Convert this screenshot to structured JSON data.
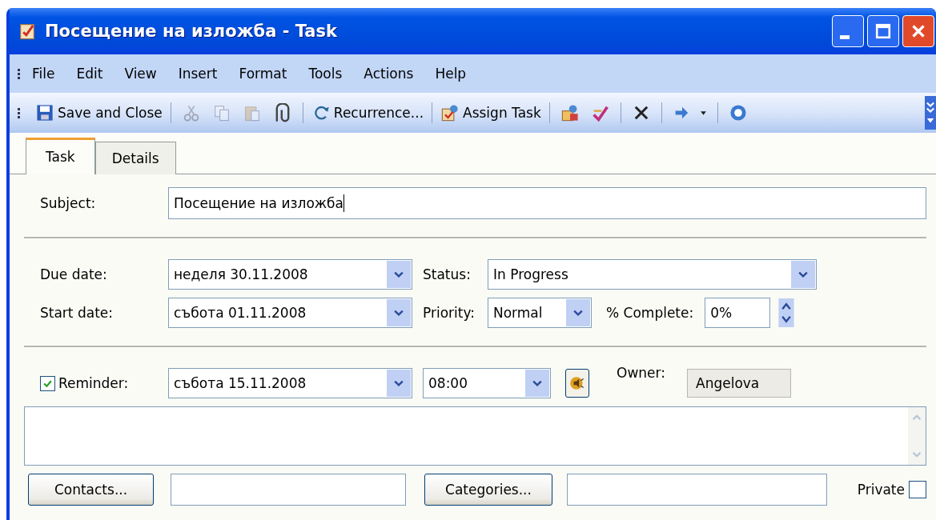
{
  "window": {
    "title": "Посещение на изложба - Task"
  },
  "menu": [
    "File",
    "Edit",
    "View",
    "Insert",
    "Format",
    "Tools",
    "Actions",
    "Help"
  ],
  "toolbar": [
    {
      "kind": "text",
      "label": "Save and Close"
    },
    {
      "kind": "sep"
    },
    {
      "kind": "icon",
      "disabled": true
    },
    {
      "kind": "icon",
      "disabled": true
    },
    {
      "kind": "icon",
      "disabled": true
    },
    {
      "kind": "icon",
      "disabled": false
    },
    {
      "kind": "sep"
    },
    {
      "kind": "text",
      "label": "Recurrence..."
    },
    {
      "kind": "sep"
    },
    {
      "kind": "text",
      "label": "Assign Task"
    },
    {
      "kind": "sep"
    },
    {
      "kind": "icon",
      "disabled": false
    },
    {
      "kind": "icon",
      "disabled": false
    },
    {
      "kind": "sep"
    },
    {
      "kind": "icon",
      "disabled": false
    },
    {
      "kind": "sep"
    },
    {
      "kind": "icon",
      "disabled": false
    },
    {
      "kind": "sep"
    },
    {
      "kind": "icon",
      "disabled": false
    }
  ],
  "tabs": [
    {
      "label": "Task",
      "selected": true
    },
    {
      "label": "Details",
      "selected": false
    }
  ],
  "subject": {
    "label": "Subject:",
    "value": "Посещение на изложба"
  },
  "due_date": {
    "label": "Due date:",
    "value": "неделя 30.11.2008"
  },
  "start_date": {
    "label": "Start date:",
    "value": "събота 01.11.2008"
  },
  "status": {
    "label": "Status:",
    "value": "In Progress"
  },
  "priority": {
    "label": "Priority:",
    "value": "Normal"
  },
  "complete": {
    "label": "% Complete:",
    "value": "0%"
  },
  "reminder": {
    "label": "Reminder:",
    "checked": true,
    "date": "събота 15.11.2008",
    "time": "08:00"
  },
  "owner": {
    "label": "Owner:",
    "value": "Angelova"
  },
  "contacts": {
    "button": "Contacts..."
  },
  "categories": {
    "button": "Categories..."
  },
  "private": {
    "label": "Private",
    "checked": false
  }
}
